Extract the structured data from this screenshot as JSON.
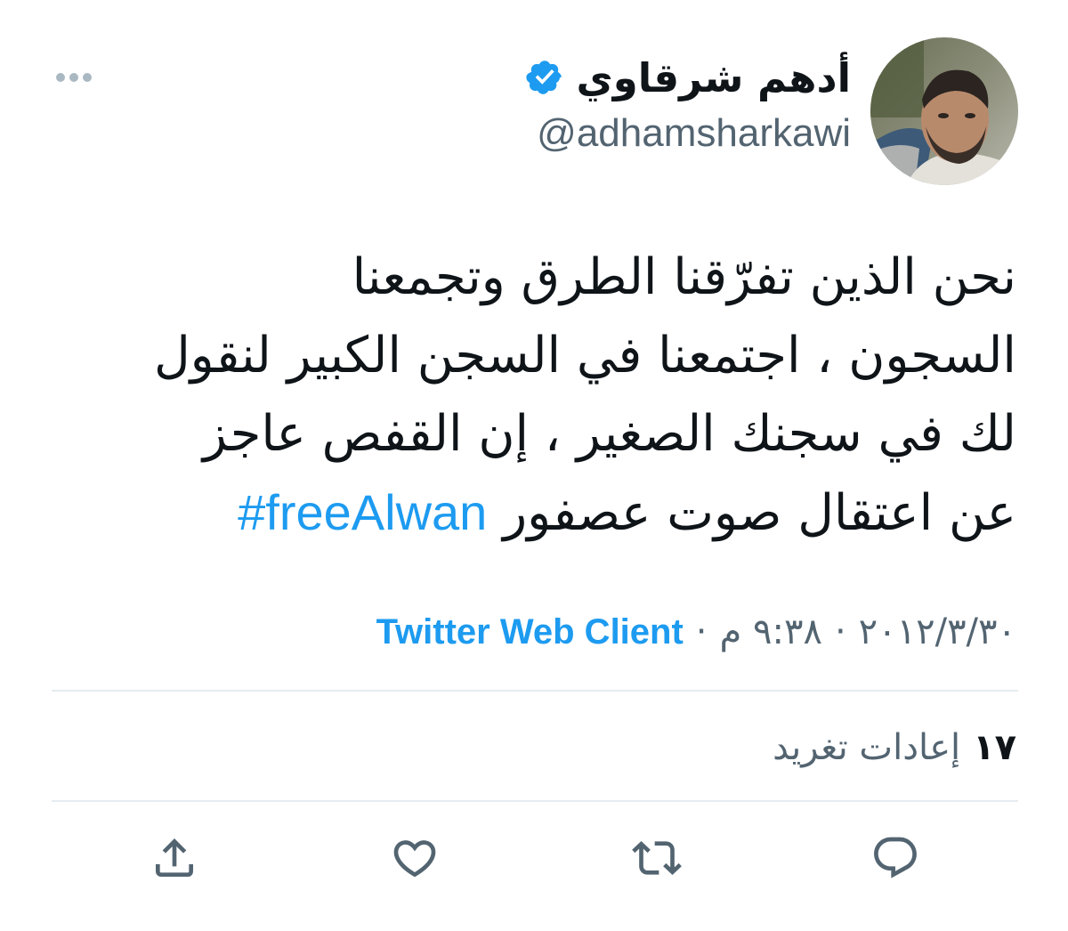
{
  "tweet": {
    "display_name": "أدهم شرقاوي",
    "handle": "@adhamsharkawi",
    "verified": true,
    "text": "نحن الذين تفرّقنا الطرق وتجمعنا\nالسجون ، اجتمعنا في السجن الكبير لنقول\nلك في سجنك الصغير ، إن القفص عاجز\nعن اعتقال صوت عصفور ",
    "hashtag": "#freeAlwan",
    "date": "٢٠١٢/٣/٣٠",
    "time": "٩:٣٨ م",
    "separator": "·",
    "client": "Twitter Web Client",
    "retweet_count": "١٧",
    "retweet_label": "إعادات تغريد"
  },
  "icons": {
    "more": "more-horizontal-icon",
    "verified": "verified-badge-icon",
    "reply": "reply-icon",
    "retweet": "retweet-icon",
    "like": "heart-icon",
    "share": "share-icon"
  },
  "colors": {
    "accent": "#1d9bf0",
    "secondary_text": "#536471",
    "primary_text": "#0f1419",
    "divider": "#e6ecf0",
    "icon_gray": "#536471",
    "more_dots": "#aab8c2"
  }
}
